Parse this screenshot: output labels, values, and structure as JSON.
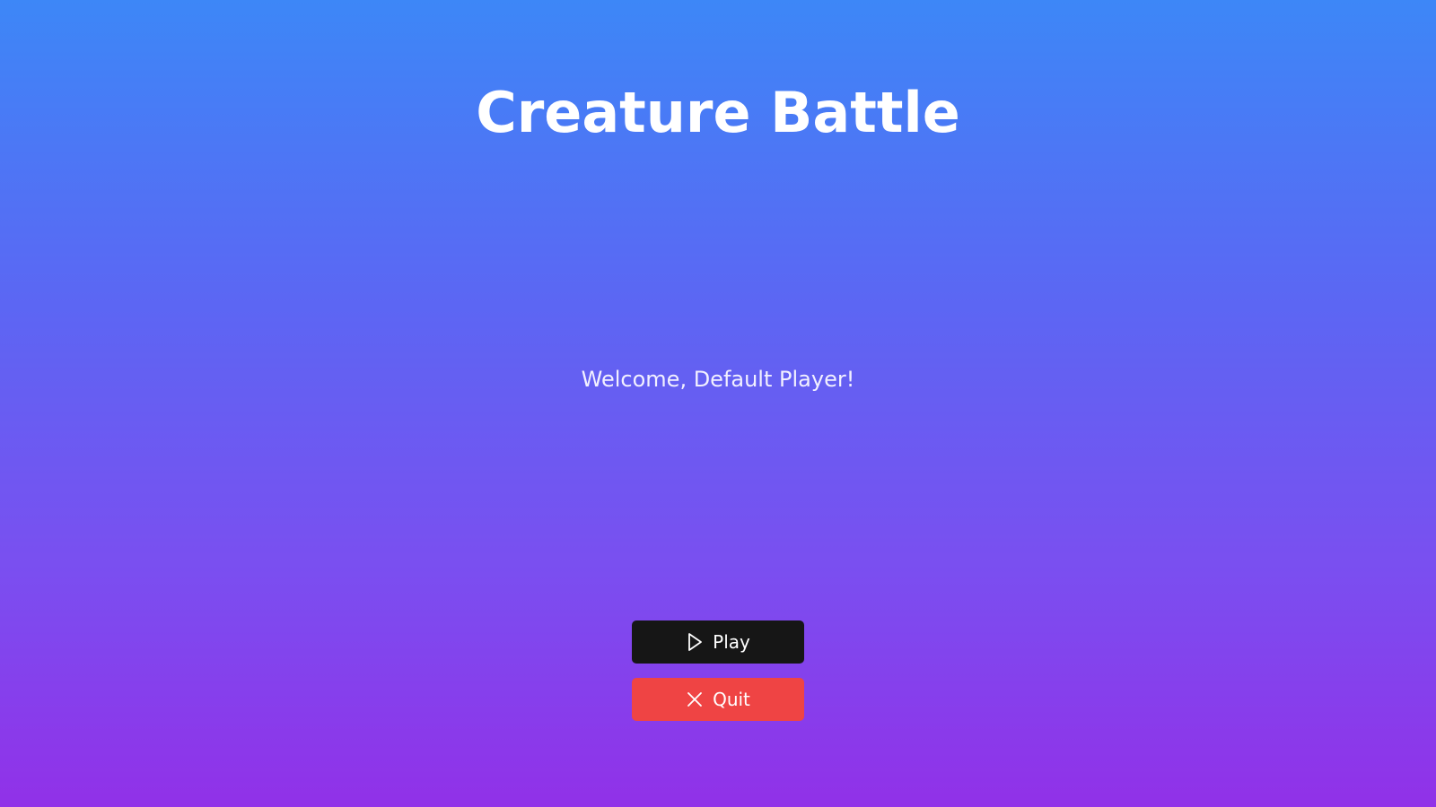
{
  "game": {
    "title": "Creature Battle",
    "welcome_message": "Welcome, Default Player!"
  },
  "menu": {
    "play": {
      "label": "Play",
      "icon": "play-icon",
      "color": "#161616"
    },
    "quit": {
      "label": "Quit",
      "icon": "close-icon",
      "color": "#ef4444"
    }
  },
  "theme": {
    "gradient_top": "#3d87f7",
    "gradient_bottom": "#9131e8",
    "text_color": "#ffffff"
  }
}
